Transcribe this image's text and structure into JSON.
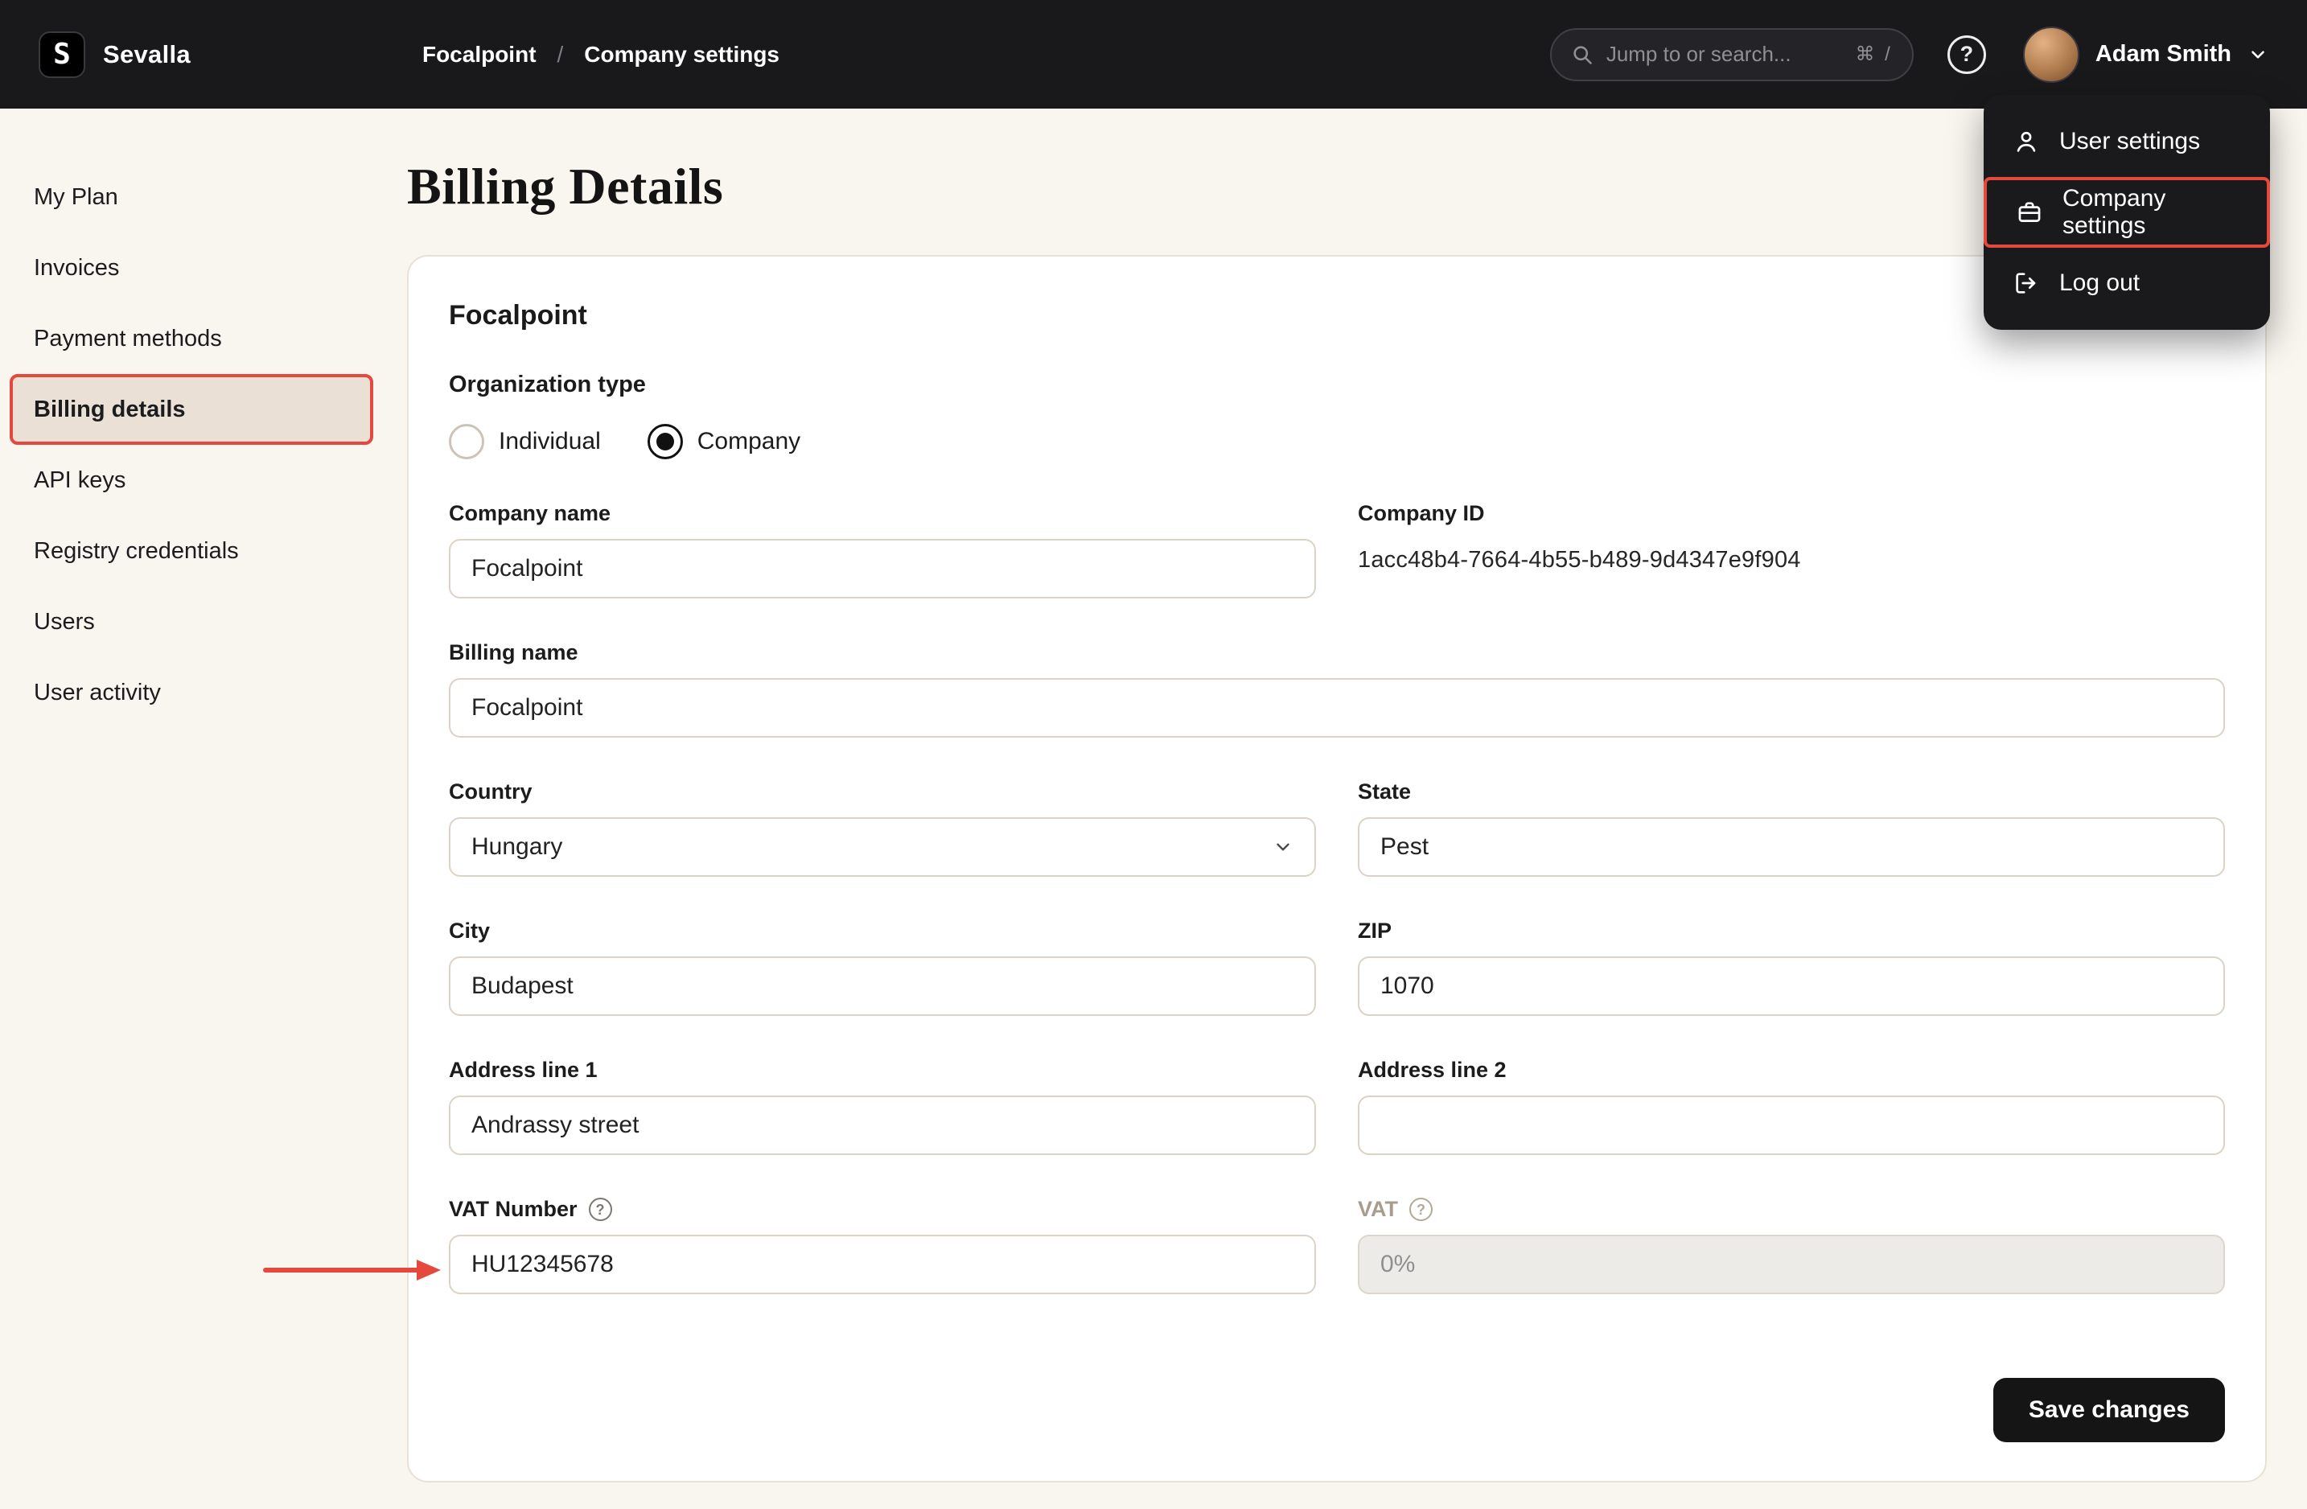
{
  "topbar": {
    "brand": "Sevalla",
    "logo_glyph": "S",
    "breadcrumb": {
      "project": "Focalpoint",
      "separator": "/",
      "page": "Company settings"
    },
    "search": {
      "placeholder": "Jump to or search...",
      "shortcut": "⌘ /"
    },
    "help_glyph": "?",
    "user_name": "Adam Smith"
  },
  "user_menu": {
    "items": [
      {
        "label": "User settings",
        "icon": "user-icon"
      },
      {
        "label": "Company settings",
        "icon": "briefcase-icon",
        "highlighted": true
      },
      {
        "label": "Log out",
        "icon": "logout-icon"
      }
    ]
  },
  "sidebar": {
    "items": [
      {
        "label": "My Plan",
        "active": false
      },
      {
        "label": "Invoices",
        "active": false
      },
      {
        "label": "Payment methods",
        "active": false
      },
      {
        "label": "Billing details",
        "active": true
      },
      {
        "label": "API keys",
        "active": false
      },
      {
        "label": "Registry credentials",
        "active": false
      },
      {
        "label": "Users",
        "active": false
      },
      {
        "label": "User activity",
        "active": false
      }
    ]
  },
  "page": {
    "title": "Billing Details",
    "card": {
      "company_title": "Focalpoint",
      "organization_type_label": "Organization type",
      "org_options": [
        {
          "label": "Individual",
          "selected": false
        },
        {
          "label": "Company",
          "selected": true
        }
      ],
      "fields": {
        "company_name": {
          "label": "Company name",
          "value": "Focalpoint"
        },
        "company_id": {
          "label": "Company ID",
          "value": "1acc48b4-7664-4b55-b489-9d4347e9f904"
        },
        "billing_name": {
          "label": "Billing name",
          "value": "Focalpoint"
        },
        "country": {
          "label": "Country",
          "value": "Hungary"
        },
        "state": {
          "label": "State",
          "value": "Pest"
        },
        "city": {
          "label": "City",
          "value": "Budapest"
        },
        "zip": {
          "label": "ZIP",
          "value": "1070"
        },
        "address_line_1": {
          "label": "Address line 1",
          "value": ""
        },
        "address_line_1_value": "Andrassy street",
        "address_line_2": {
          "label": "Address line 2",
          "value": ""
        },
        "vat_number": {
          "label": "VAT Number",
          "value": "HU12345678"
        },
        "vat": {
          "label": "VAT",
          "value": "0%",
          "disabled": true
        }
      },
      "save_button": "Save changes"
    }
  },
  "annotations": {
    "accent_color": "#e5483d",
    "question_glyph": "?"
  }
}
